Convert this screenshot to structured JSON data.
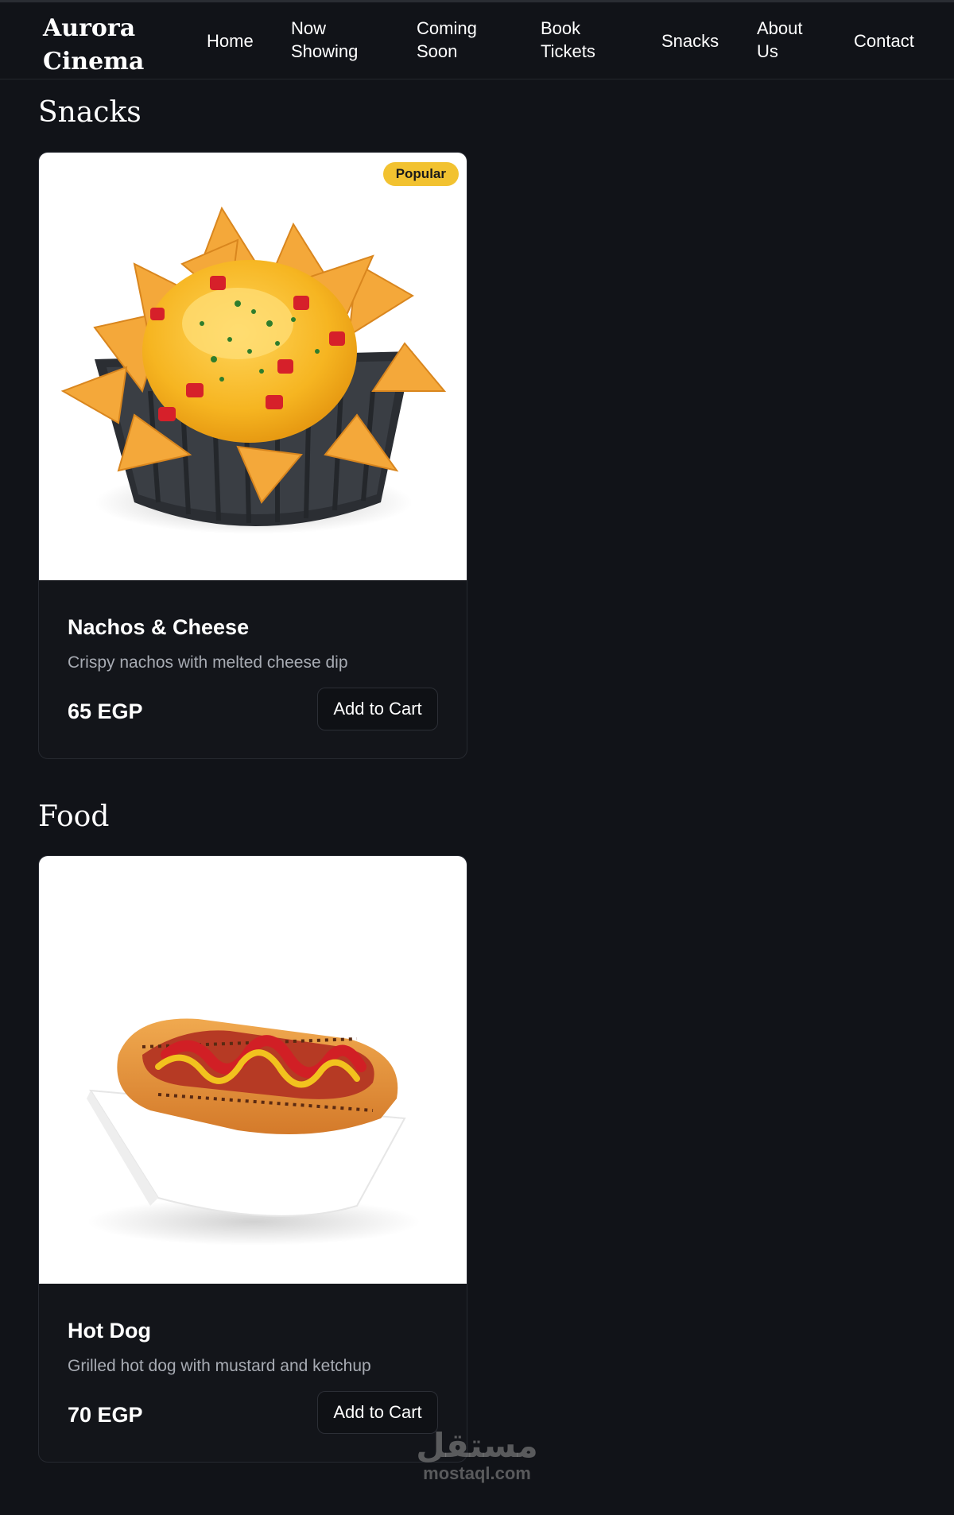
{
  "brand": {
    "line1": "Aurora",
    "line2": "Cinema"
  },
  "nav": {
    "home": "Home",
    "now_showing": [
      "Now",
      "Showing"
    ],
    "coming_soon": [
      "Coming",
      "Soon"
    ],
    "book_tickets": [
      "Book",
      "Tickets"
    ],
    "snacks": "Snacks",
    "about_us": [
      "About",
      "Us"
    ],
    "contact": "Contact"
  },
  "sections": {
    "snacks": {
      "title": "Snacks",
      "item": {
        "badge": "Popular",
        "name": "Nachos & Cheese",
        "description": "Crispy nachos with melted cheese dip",
        "price": "65 EGP",
        "button": "Add to Cart",
        "image_icon": "nachos-image"
      }
    },
    "food": {
      "title": "Food",
      "item": {
        "name": "Hot Dog",
        "description": "Grilled hot dog with mustard and ketchup",
        "price": "70 EGP",
        "button": "Add to Cart",
        "image_icon": "hotdog-image"
      }
    }
  },
  "watermark": {
    "arabic": "مستقل",
    "latin": "mostaql.com"
  },
  "colors": {
    "background": "#111318",
    "card": "#13151a",
    "badge": "#f2c230",
    "muted_text": "#a7abb3"
  }
}
